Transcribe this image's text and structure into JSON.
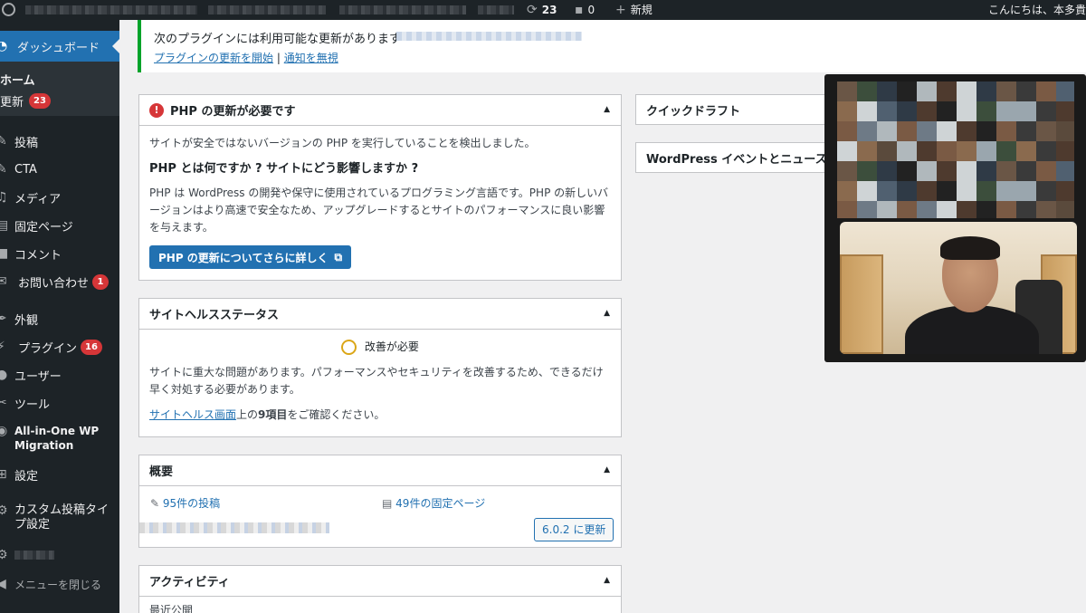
{
  "adminbar": {
    "updates_count": "23",
    "comments_count": "0",
    "new_label": "新規",
    "greeting": "こんにちは、本多貴",
    "icons": {
      "updates": "refresh-icon",
      "comments": "comment-icon",
      "new": "plus-icon"
    }
  },
  "sidebar": {
    "items": [
      {
        "label": "ダッシュボード",
        "icon": "dashboard-icon"
      },
      {
        "label": "投稿",
        "icon": "pin-icon"
      },
      {
        "label": "CTA",
        "icon": "pin-icon"
      },
      {
        "label": "メディア",
        "icon": "media-icon"
      },
      {
        "label": "固定ページ",
        "icon": "page-icon"
      },
      {
        "label": "コメント",
        "icon": "comment-icon"
      },
      {
        "label": "お問い合わせ",
        "icon": "mail-icon",
        "badge": "1"
      },
      {
        "label": "外観",
        "icon": "brush-icon"
      },
      {
        "label": "プラグイン",
        "icon": "plugin-icon",
        "badge": "16"
      },
      {
        "label": "ユーザー",
        "icon": "user-icon"
      },
      {
        "label": "ツール",
        "icon": "wrench-icon"
      },
      {
        "label": "All-in-One WP",
        "label2": "Migration",
        "icon": "migration-icon"
      },
      {
        "label": "設定",
        "icon": "settings-icon"
      },
      {
        "label": "カスタム投稿タイ",
        "label2": "プ設定",
        "icon": "gear-icon"
      }
    ],
    "submenu": {
      "home": "ホーム",
      "updates": "更新",
      "updates_badge": "23"
    },
    "collapse_label": "メニューを閉じる"
  },
  "notice": {
    "text": "次のプラグインには利用可能な更新があります",
    "link_update": "プラグインの更新を開始",
    "separator": "|",
    "link_dismiss": "通知を無視"
  },
  "php_box": {
    "title": "PHP の更新が必要です",
    "intro": "サイトが安全ではないバージョンの PHP を実行していることを検出しました。",
    "heading": "PHP とは何ですか ? サイトにどう影響しますか ?",
    "body": "PHP は WordPress の開発や保守に使用されているプログラミング言語です。PHP の新しいバージョンはより高速で安全なため、アップグレードするとサイトのパフォーマンスに良い影響を与えます。",
    "button": "PHP の更新についてさらに詳しく"
  },
  "health_box": {
    "title": "サイトヘルスステータス",
    "status": "改善が必要",
    "body": "サイトに重大な問題があります。パフォーマンスやセキュリティを改善するため、できるだけ早く対処する必要があります。",
    "link": "サイトヘルス画面",
    "suffix_before": "上の",
    "count": "9項目",
    "suffix_after": "をご確認ください。"
  },
  "glance_box": {
    "title": "概要",
    "posts": "95件の投稿",
    "pages": "49件の固定ページ",
    "update_button": "6.0.2 に更新"
  },
  "activity_box": {
    "title": "アクティビティ",
    "recent": "最近公開"
  },
  "quickdraft_box": {
    "title": "クイックドラフト"
  },
  "events_box": {
    "title": "WordPress イベントとニュース"
  },
  "colors": {
    "accent": "#2271b1",
    "admin_bg": "#1d2327",
    "success": "#00a32a",
    "error": "#d63638",
    "warning": "#dba617"
  }
}
